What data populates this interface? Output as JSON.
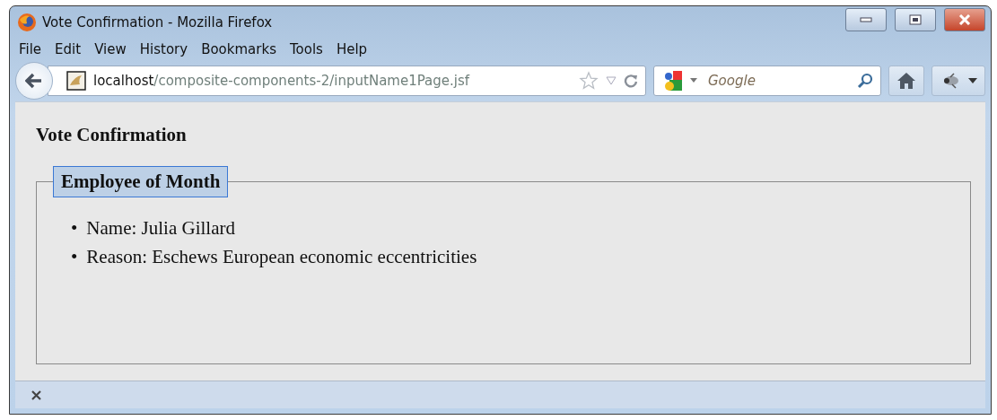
{
  "window": {
    "title": "Vote Confirmation - Mozilla Firefox"
  },
  "menu": [
    "File",
    "Edit",
    "View",
    "History",
    "Bookmarks",
    "Tools",
    "Help"
  ],
  "address": {
    "host": "localhost",
    "path": "/composite-components-2/inputName1Page.jsf"
  },
  "search": {
    "placeholder": "Google"
  },
  "page": {
    "heading": "Vote Confirmation",
    "fieldset": {
      "legend": "Employee of Month",
      "items": [
        {
          "marker": "•",
          "text": "Name: Julia Gillard"
        },
        {
          "marker": "•",
          "text": "Reason: Eschews European economic eccentricities"
        }
      ]
    }
  }
}
